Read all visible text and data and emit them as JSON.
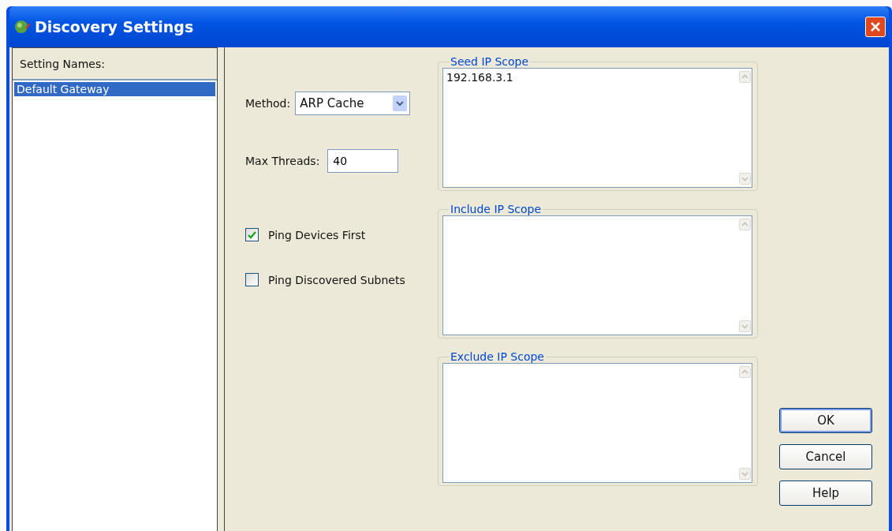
{
  "window": {
    "title": "Discovery Settings"
  },
  "settings_list": {
    "label": "Setting Names:",
    "items": [
      {
        "label": "Default Gateway",
        "selected": true
      }
    ]
  },
  "method": {
    "label": "Method:",
    "value": "ARP Cache"
  },
  "max_threads": {
    "label": "Max Threads:",
    "value": "40"
  },
  "checkboxes": [
    {
      "label": "Ping Devices First",
      "checked": true
    },
    {
      "label": "Ping Discovered Subnets",
      "checked": false
    }
  ],
  "scopes": [
    {
      "title": "Seed IP Scope",
      "value": "192.168.3.1"
    },
    {
      "title": "Include IP Scope"
    },
    {
      "title": "Exclude IP Scope"
    }
  ],
  "buttons": [
    {
      "label": "OK",
      "default": true
    },
    {
      "label": "Cancel",
      "default": false
    },
    {
      "label": "Help",
      "default": false
    }
  ]
}
